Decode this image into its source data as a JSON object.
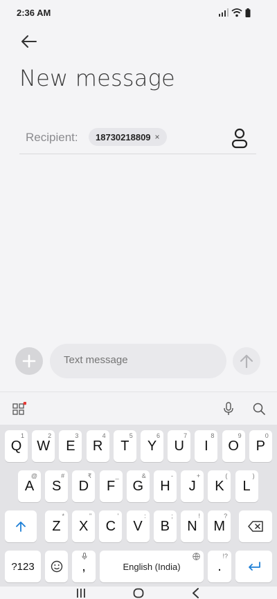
{
  "status": {
    "time": "2:36 AM"
  },
  "header": {
    "title": "New message"
  },
  "recipient": {
    "label": "Recipient:",
    "chip_number": "18730218809",
    "chip_remove": "×"
  },
  "compose": {
    "placeholder": "Text message"
  },
  "keyboard": {
    "row1": [
      {
        "k": "Q",
        "h": "1"
      },
      {
        "k": "W",
        "h": "2"
      },
      {
        "k": "E",
        "h": "3"
      },
      {
        "k": "R",
        "h": "4"
      },
      {
        "k": "T",
        "h": "5"
      },
      {
        "k": "Y",
        "h": "6"
      },
      {
        "k": "U",
        "h": "7"
      },
      {
        "k": "I",
        "h": "8"
      },
      {
        "k": "O",
        "h": "9"
      },
      {
        "k": "P",
        "h": "0"
      }
    ],
    "row2": [
      {
        "k": "A",
        "h": "@"
      },
      {
        "k": "S",
        "h": "#"
      },
      {
        "k": "D",
        "h": "₹"
      },
      {
        "k": "F",
        "h": "_"
      },
      {
        "k": "G",
        "h": "&"
      },
      {
        "k": "H",
        "h": "-"
      },
      {
        "k": "J",
        "h": "+"
      },
      {
        "k": "K",
        "h": "("
      },
      {
        "k": "L",
        "h": ")"
      }
    ],
    "row3": [
      {
        "k": "Z",
        "h": "*"
      },
      {
        "k": "X",
        "h": "\""
      },
      {
        "k": "C",
        "h": "'"
      },
      {
        "k": "V",
        "h": ":"
      },
      {
        "k": "B",
        "h": ";"
      },
      {
        "k": "N",
        "h": "!"
      },
      {
        "k": "M",
        "h": "?"
      }
    ],
    "symbols_label": "?123",
    "comma": ",",
    "space_label": "English (India)",
    "period": ".",
    "period_hint": "!?"
  },
  "colors": {
    "accent": "#1d7fd6",
    "notification_dot": "#e53935"
  }
}
